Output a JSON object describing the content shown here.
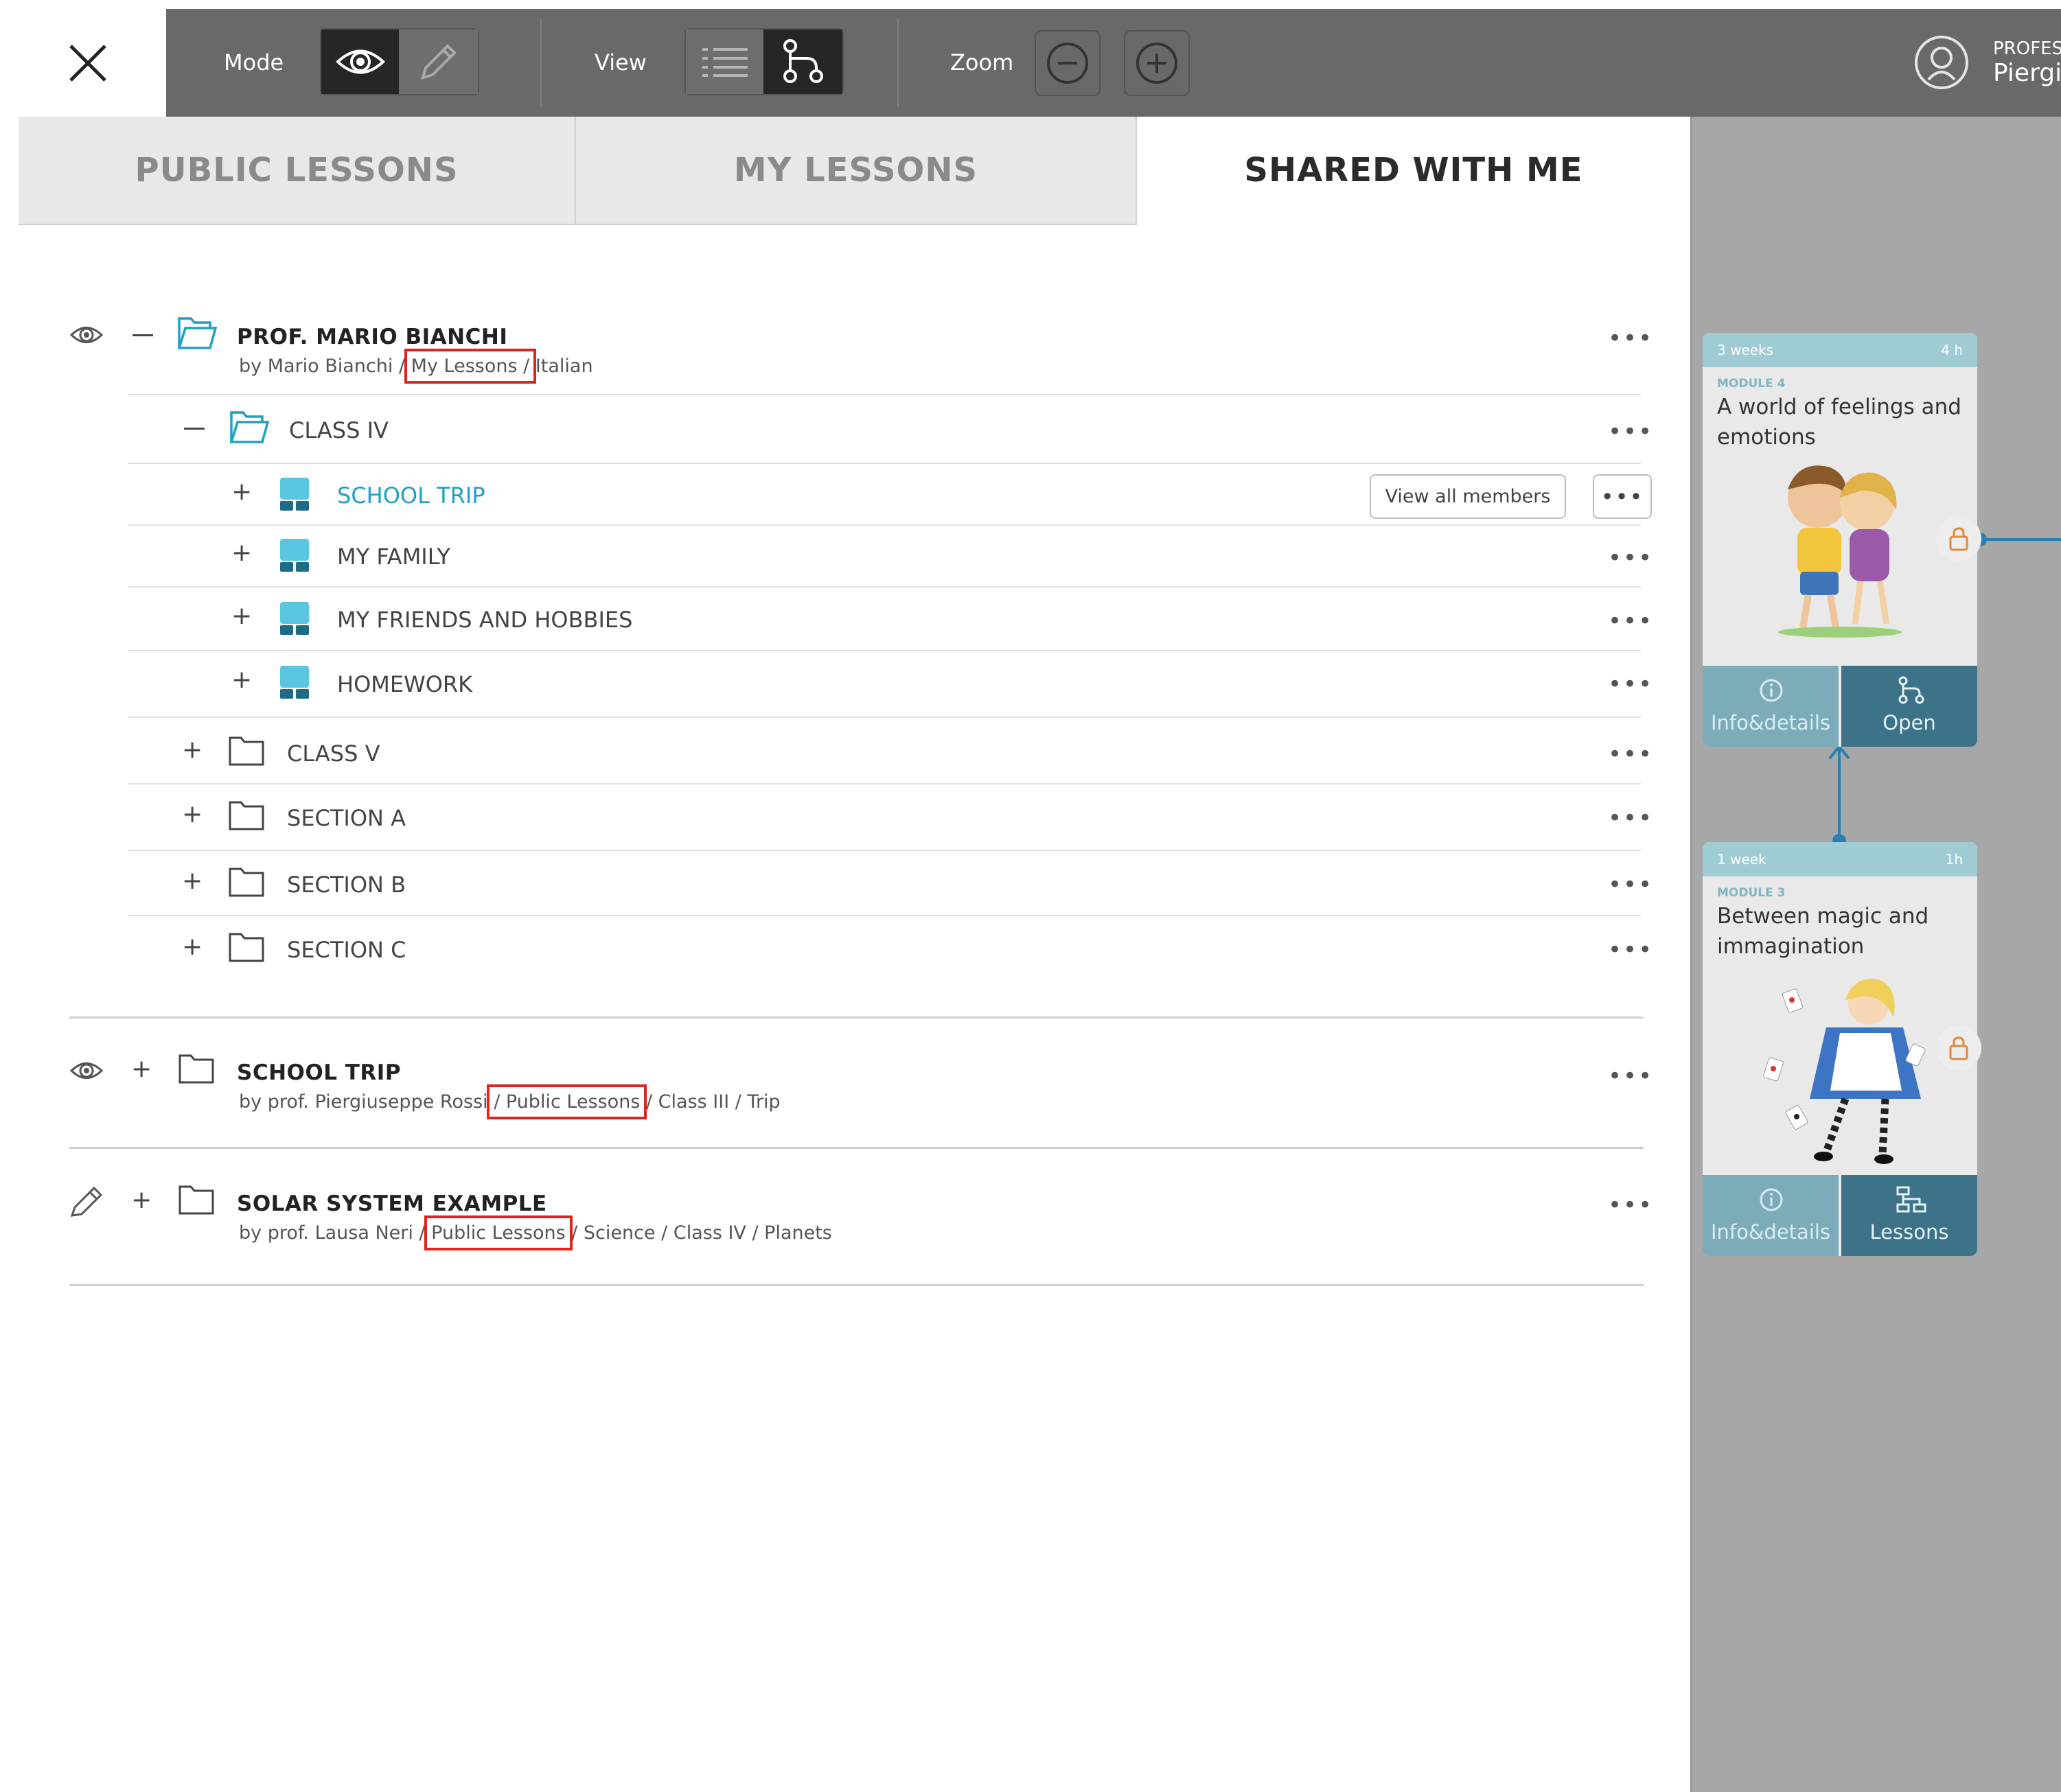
{
  "toolbar": {
    "mode_label": "Mode",
    "view_label": "View",
    "zoom_label": "Zoom"
  },
  "profile": {
    "role": "PROFES",
    "name": "Piergi"
  },
  "tabs": [
    {
      "label": "PUBLIC LESSONS",
      "active": false
    },
    {
      "label": "MY LESSONS",
      "active": false
    },
    {
      "label": "SHARED WITH ME",
      "active": true
    }
  ],
  "tree": {
    "mario": {
      "title": "PROF. MARIO BIANCHI",
      "by": "by Mario Bianchi /",
      "path_highlight": "My Lessons /",
      "path_rest": "Italian",
      "class4": "CLASS IV",
      "school_trip": "SCHOOL TRIP",
      "view_all_members": "View all members",
      "my_family": "MY FAMILY",
      "friends": "MY FRIENDS AND HOBBIES",
      "homework": "HOMEWORK",
      "class5": "CLASS V",
      "sectionA": "SECTION A",
      "sectionB": "SECTION B",
      "sectionC": "SECTION C"
    },
    "trip": {
      "title": "SCHOOL TRIP",
      "by": "by prof. Piergiuseppe Rossi",
      "path_highlight": "/ Public Lessons",
      "path_rest": "/ Class III / Trip"
    },
    "solar": {
      "title": "SOLAR SYSTEM EXAMPLE",
      "by": "by prof. Lausa Neri /",
      "path_highlight": "Public Lessons",
      "path_rest": "/ Science / Class IV / Planets"
    },
    "more": "•••"
  },
  "cards": [
    {
      "duration": "3 weeks",
      "hours": "4 h",
      "module": "MODULE 4",
      "title": "A world of feelings and emotions",
      "left_button": "Info&details",
      "right_button": "Open"
    },
    {
      "duration": "1 week",
      "hours": "1h",
      "module": "MODULE 3",
      "title": "Between magic and immagination",
      "left_button": "Info&details",
      "right_button": "Lessons"
    }
  ],
  "colors": {
    "topbar": "#696969",
    "accent_blue": "#1ea0c3",
    "highlight_red": "#e0231e",
    "card_dark": "#3d7389"
  }
}
